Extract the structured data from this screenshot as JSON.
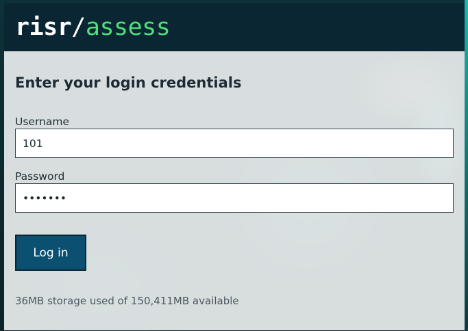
{
  "brand": {
    "part1": "risr",
    "separator": "/",
    "part2": "assess"
  },
  "login": {
    "title": "Enter your login credentials",
    "username_label": "Username",
    "username_value": "101",
    "password_label": "Password",
    "password_value": "•••••••",
    "submit_label": "Log in"
  },
  "storage_text": "36MB storage used of 150,411MB available",
  "colors": {
    "header_bg": "#0a2633",
    "accent_green": "#4ee07a",
    "button_bg": "#0b5070"
  }
}
